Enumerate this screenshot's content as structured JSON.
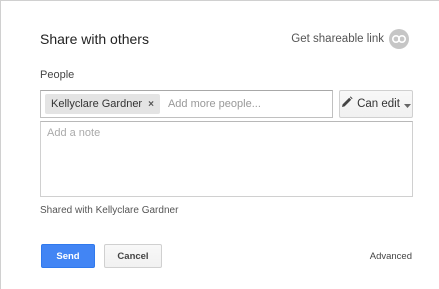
{
  "dialog": {
    "title": "Share with others",
    "shareable_link_label": "Get shareable link",
    "people_label": "People",
    "chips": [
      {
        "label": "Kellyclare Gardner",
        "remove_glyph": "×"
      }
    ],
    "people_placeholder": "Add more people...",
    "permission": {
      "label": "Can edit",
      "icon": "pencil-icon"
    },
    "note_placeholder": "Add a note",
    "shared_with_text": "Shared with Kellyclare Gardner",
    "send_label": "Send",
    "cancel_label": "Cancel",
    "advanced_label": "Advanced"
  },
  "colors": {
    "primary": "#4285f4",
    "chip_bg": "#e4e4e4",
    "link_icon_bg": "#c6c6c6"
  }
}
